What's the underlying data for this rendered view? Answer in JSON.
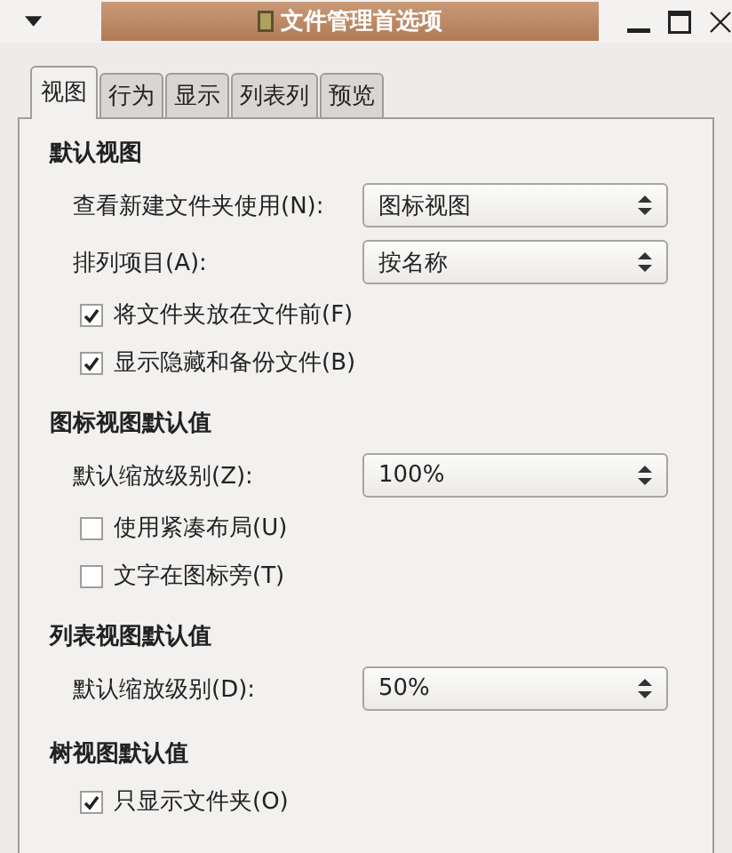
{
  "window": {
    "title": "文件管理首选项"
  },
  "tabs": [
    {
      "label": "视图",
      "selected": true
    },
    {
      "label": "行为",
      "selected": false
    },
    {
      "label": "显示",
      "selected": false
    },
    {
      "label": "列表列",
      "selected": false
    },
    {
      "label": "预览",
      "selected": false
    }
  ],
  "sections": [
    {
      "title": "默认视图",
      "items": [
        {
          "kind": "combo",
          "label": "查看新建文件夹使用(N):",
          "value": "图标视图"
        },
        {
          "kind": "combo",
          "label": "排列项目(A):",
          "value": "按名称"
        },
        {
          "kind": "checkbox",
          "label": "将文件夹放在文件前(F)",
          "checked": true
        },
        {
          "kind": "checkbox",
          "label": "显示隐藏和备份文件(B)",
          "checked": true
        }
      ]
    },
    {
      "title": "图标视图默认值",
      "items": [
        {
          "kind": "combo",
          "label": "默认缩放级别(Z):",
          "value": "100%"
        },
        {
          "kind": "checkbox",
          "label": "使用紧凑布局(U)",
          "checked": false
        },
        {
          "kind": "checkbox",
          "label": "文字在图标旁(T)",
          "checked": false
        }
      ]
    },
    {
      "title": "列表视图默认值",
      "items": [
        {
          "kind": "combo",
          "label": "默认缩放级别(D):",
          "value": "50%"
        }
      ]
    },
    {
      "title": "树视图默认值",
      "items": [
        {
          "kind": "checkbox",
          "label": "只显示文件夹(O)",
          "checked": true
        }
      ]
    }
  ]
}
